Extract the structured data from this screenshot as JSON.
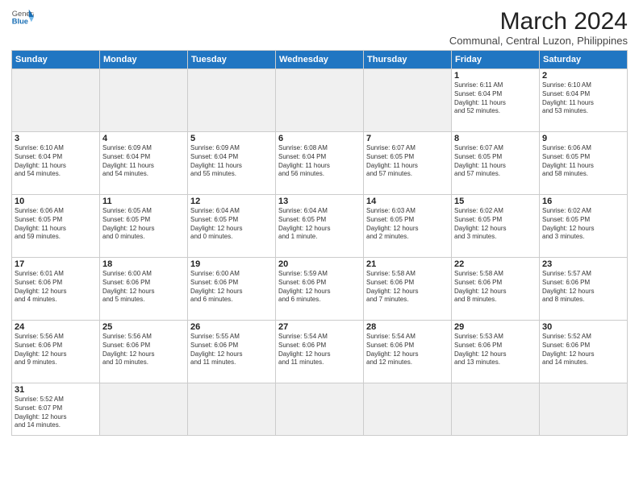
{
  "header": {
    "logo_general": "General",
    "logo_blue": "Blue",
    "month_year": "March 2024",
    "location": "Communal, Central Luzon, Philippines"
  },
  "days_of_week": [
    "Sunday",
    "Monday",
    "Tuesday",
    "Wednesday",
    "Thursday",
    "Friday",
    "Saturday"
  ],
  "weeks": [
    [
      {
        "num": "",
        "info": ""
      },
      {
        "num": "",
        "info": ""
      },
      {
        "num": "",
        "info": ""
      },
      {
        "num": "",
        "info": ""
      },
      {
        "num": "",
        "info": ""
      },
      {
        "num": "1",
        "info": "Sunrise: 6:11 AM\nSunset: 6:04 PM\nDaylight: 11 hours\nand 52 minutes."
      },
      {
        "num": "2",
        "info": "Sunrise: 6:10 AM\nSunset: 6:04 PM\nDaylight: 11 hours\nand 53 minutes."
      }
    ],
    [
      {
        "num": "3",
        "info": "Sunrise: 6:10 AM\nSunset: 6:04 PM\nDaylight: 11 hours\nand 54 minutes."
      },
      {
        "num": "4",
        "info": "Sunrise: 6:09 AM\nSunset: 6:04 PM\nDaylight: 11 hours\nand 54 minutes."
      },
      {
        "num": "5",
        "info": "Sunrise: 6:09 AM\nSunset: 6:04 PM\nDaylight: 11 hours\nand 55 minutes."
      },
      {
        "num": "6",
        "info": "Sunrise: 6:08 AM\nSunset: 6:04 PM\nDaylight: 11 hours\nand 56 minutes."
      },
      {
        "num": "7",
        "info": "Sunrise: 6:07 AM\nSunset: 6:05 PM\nDaylight: 11 hours\nand 57 minutes."
      },
      {
        "num": "8",
        "info": "Sunrise: 6:07 AM\nSunset: 6:05 PM\nDaylight: 11 hours\nand 57 minutes."
      },
      {
        "num": "9",
        "info": "Sunrise: 6:06 AM\nSunset: 6:05 PM\nDaylight: 11 hours\nand 58 minutes."
      }
    ],
    [
      {
        "num": "10",
        "info": "Sunrise: 6:06 AM\nSunset: 6:05 PM\nDaylight: 11 hours\nand 59 minutes."
      },
      {
        "num": "11",
        "info": "Sunrise: 6:05 AM\nSunset: 6:05 PM\nDaylight: 12 hours\nand 0 minutes."
      },
      {
        "num": "12",
        "info": "Sunrise: 6:04 AM\nSunset: 6:05 PM\nDaylight: 12 hours\nand 0 minutes."
      },
      {
        "num": "13",
        "info": "Sunrise: 6:04 AM\nSunset: 6:05 PM\nDaylight: 12 hours\nand 1 minute."
      },
      {
        "num": "14",
        "info": "Sunrise: 6:03 AM\nSunset: 6:05 PM\nDaylight: 12 hours\nand 2 minutes."
      },
      {
        "num": "15",
        "info": "Sunrise: 6:02 AM\nSunset: 6:05 PM\nDaylight: 12 hours\nand 3 minutes."
      },
      {
        "num": "16",
        "info": "Sunrise: 6:02 AM\nSunset: 6:05 PM\nDaylight: 12 hours\nand 3 minutes."
      }
    ],
    [
      {
        "num": "17",
        "info": "Sunrise: 6:01 AM\nSunset: 6:06 PM\nDaylight: 12 hours\nand 4 minutes."
      },
      {
        "num": "18",
        "info": "Sunrise: 6:00 AM\nSunset: 6:06 PM\nDaylight: 12 hours\nand 5 minutes."
      },
      {
        "num": "19",
        "info": "Sunrise: 6:00 AM\nSunset: 6:06 PM\nDaylight: 12 hours\nand 6 minutes."
      },
      {
        "num": "20",
        "info": "Sunrise: 5:59 AM\nSunset: 6:06 PM\nDaylight: 12 hours\nand 6 minutes."
      },
      {
        "num": "21",
        "info": "Sunrise: 5:58 AM\nSunset: 6:06 PM\nDaylight: 12 hours\nand 7 minutes."
      },
      {
        "num": "22",
        "info": "Sunrise: 5:58 AM\nSunset: 6:06 PM\nDaylight: 12 hours\nand 8 minutes."
      },
      {
        "num": "23",
        "info": "Sunrise: 5:57 AM\nSunset: 6:06 PM\nDaylight: 12 hours\nand 8 minutes."
      }
    ],
    [
      {
        "num": "24",
        "info": "Sunrise: 5:56 AM\nSunset: 6:06 PM\nDaylight: 12 hours\nand 9 minutes."
      },
      {
        "num": "25",
        "info": "Sunrise: 5:56 AM\nSunset: 6:06 PM\nDaylight: 12 hours\nand 10 minutes."
      },
      {
        "num": "26",
        "info": "Sunrise: 5:55 AM\nSunset: 6:06 PM\nDaylight: 12 hours\nand 11 minutes."
      },
      {
        "num": "27",
        "info": "Sunrise: 5:54 AM\nSunset: 6:06 PM\nDaylight: 12 hours\nand 11 minutes."
      },
      {
        "num": "28",
        "info": "Sunrise: 5:54 AM\nSunset: 6:06 PM\nDaylight: 12 hours\nand 12 minutes."
      },
      {
        "num": "29",
        "info": "Sunrise: 5:53 AM\nSunset: 6:06 PM\nDaylight: 12 hours\nand 13 minutes."
      },
      {
        "num": "30",
        "info": "Sunrise: 5:52 AM\nSunset: 6:06 PM\nDaylight: 12 hours\nand 14 minutes."
      }
    ],
    [
      {
        "num": "31",
        "info": "Sunrise: 5:52 AM\nSunset: 6:07 PM\nDaylight: 12 hours\nand 14 minutes."
      },
      {
        "num": "",
        "info": ""
      },
      {
        "num": "",
        "info": ""
      },
      {
        "num": "",
        "info": ""
      },
      {
        "num": "",
        "info": ""
      },
      {
        "num": "",
        "info": ""
      },
      {
        "num": "",
        "info": ""
      }
    ]
  ]
}
